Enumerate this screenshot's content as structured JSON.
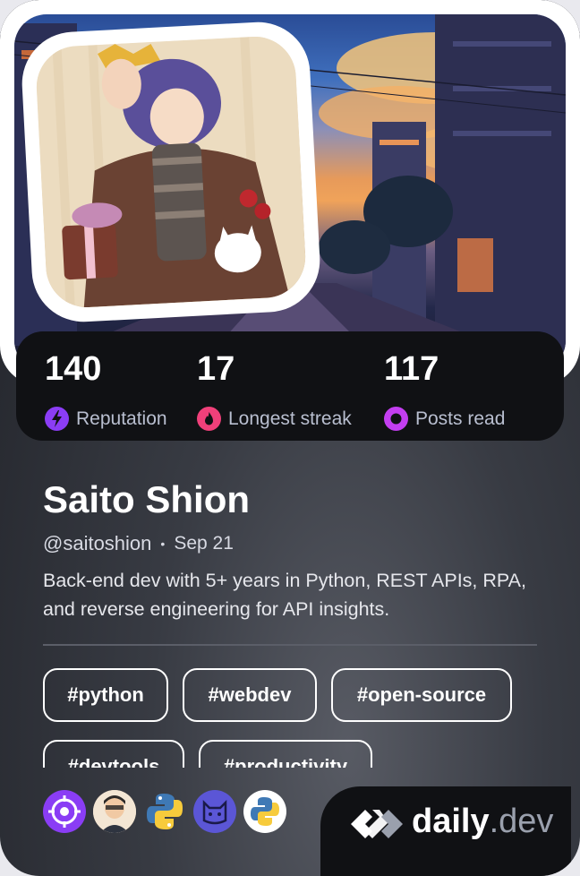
{
  "profile": {
    "name": "Saito Shion",
    "handle": "@saitoshion",
    "joined": "Sep 21",
    "bio": "Back-end dev with 5+ years in Python, REST APIs, RPA, and reverse engineering for API insights."
  },
  "stats": [
    {
      "value": "140",
      "label": "Reputation",
      "icon": "lightning-icon",
      "color": "#8b3df5"
    },
    {
      "value": "17",
      "label": "Longest streak",
      "icon": "flame-icon",
      "color": "#f0407a"
    },
    {
      "value": "117",
      "label": "Posts read",
      "icon": "eye-ring-icon",
      "color": "#c33ef0"
    }
  ],
  "tags": [
    "#python",
    "#webdev",
    "#open-source",
    "#devtools",
    "#productivity"
  ],
  "badges": [
    {
      "icon": "target-icon",
      "color": "#8a3df5"
    },
    {
      "icon": "user-avatar-icon",
      "color": "#e8c9a6"
    },
    {
      "icon": "python-logo-icon",
      "color": "#3f79b5"
    },
    {
      "icon": "cat-icon",
      "color": "#5b56d6"
    },
    {
      "icon": "python-logo-icon",
      "color": "#ffffff"
    }
  ],
  "brand": {
    "name": "daily",
    "suffix": ".dev"
  }
}
